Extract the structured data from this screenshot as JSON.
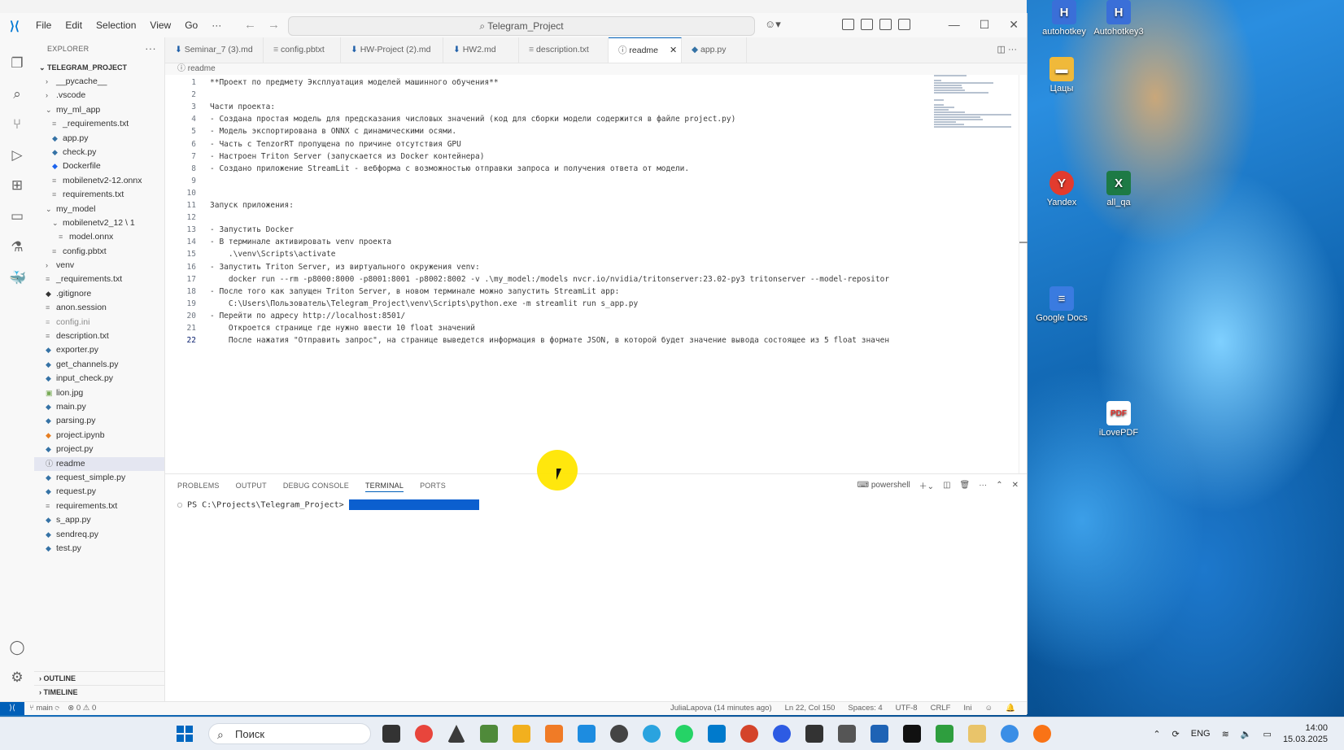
{
  "window": {
    "title": "Telegram_Project",
    "menu": [
      "File",
      "Edit",
      "Selection",
      "View",
      "Go",
      "···"
    ]
  },
  "explorer": {
    "header": "EXPLORER",
    "root": "TELEGRAM_PROJECT",
    "items": [
      {
        "label": "__pycache__",
        "indent": 1,
        "kind": "folder-closed"
      },
      {
        "label": ".vscode",
        "indent": 1,
        "kind": "folder-closed"
      },
      {
        "label": "my_ml_app",
        "indent": 1,
        "kind": "folder-open"
      },
      {
        "label": "_requirements.txt",
        "indent": 2,
        "kind": "txt"
      },
      {
        "label": "app.py",
        "indent": 2,
        "kind": "py"
      },
      {
        "label": "check.py",
        "indent": 2,
        "kind": "py"
      },
      {
        "label": "Dockerfile",
        "indent": 2,
        "kind": "docker"
      },
      {
        "label": "mobilenetv2-12.onnx",
        "indent": 2,
        "kind": "txt"
      },
      {
        "label": "requirements.txt",
        "indent": 2,
        "kind": "txt"
      },
      {
        "label": "my_model",
        "indent": 1,
        "kind": "folder-open"
      },
      {
        "label": "mobilenetv2_12 \\ 1",
        "indent": 2,
        "kind": "folder-open"
      },
      {
        "label": "model.onnx",
        "indent": 3,
        "kind": "txt"
      },
      {
        "label": "config.pbtxt",
        "indent": 2,
        "kind": "txt"
      },
      {
        "label": "venv",
        "indent": 1,
        "kind": "folder-closed"
      },
      {
        "label": "_requirements.txt",
        "indent": 1,
        "kind": "txt"
      },
      {
        "label": ".gitignore",
        "indent": 1,
        "kind": "git"
      },
      {
        "label": "anon.session",
        "indent": 1,
        "kind": "txt"
      },
      {
        "label": "config.ini",
        "indent": 1,
        "kind": "dim"
      },
      {
        "label": "description.txt",
        "indent": 1,
        "kind": "txt"
      },
      {
        "label": "exporter.py",
        "indent": 1,
        "kind": "py"
      },
      {
        "label": "get_channels.py",
        "indent": 1,
        "kind": "py"
      },
      {
        "label": "input_check.py",
        "indent": 1,
        "kind": "py"
      },
      {
        "label": "lion.jpg",
        "indent": 1,
        "kind": "img"
      },
      {
        "label": "main.py",
        "indent": 1,
        "kind": "py"
      },
      {
        "label": "parsing.py",
        "indent": 1,
        "kind": "py"
      },
      {
        "label": "project.ipynb",
        "indent": 1,
        "kind": "nb"
      },
      {
        "label": "project.py",
        "indent": 1,
        "kind": "py"
      },
      {
        "label": "readme",
        "indent": 1,
        "kind": "info",
        "selected": true
      },
      {
        "label": "request_simple.py",
        "indent": 1,
        "kind": "py"
      },
      {
        "label": "request.py",
        "indent": 1,
        "kind": "py"
      },
      {
        "label": "requirements.txt",
        "indent": 1,
        "kind": "txt"
      },
      {
        "label": "s_app.py",
        "indent": 1,
        "kind": "py"
      },
      {
        "label": "sendreq.py",
        "indent": 1,
        "kind": "py"
      },
      {
        "label": "test.py",
        "indent": 1,
        "kind": "py"
      }
    ],
    "outline": "OUTLINE",
    "timeline": "TIMELINE"
  },
  "tabs": [
    {
      "label": "Seminar_7 (3).md",
      "icon": "md"
    },
    {
      "label": "config.pbtxt",
      "icon": "txt"
    },
    {
      "label": "HW-Project (2).md",
      "icon": "md"
    },
    {
      "label": "HW2.md",
      "icon": "md"
    },
    {
      "label": "description.txt",
      "icon": "txt"
    },
    {
      "label": "readme",
      "icon": "info",
      "active": true
    },
    {
      "label": "app.py",
      "icon": "py"
    }
  ],
  "breadcrumb": "readme",
  "code_lines": [
    "**Проект по предмету Эксплуатация моделей машинного обучения**",
    "",
    "Части проекта:",
    "- Создана простая модель для предсказания числовых значений (код для сборки модели содержится в файле project.py)",
    "- Модель экспортирована в ONNX с динамическими осями.",
    "- Часть с TenzorRT пропущена по причине отсутствия GPU",
    "- Настроен Triton Server (запускается из Docker контейнера)",
    "- Создано приложение StreamLit - вебформа с возможностью отправки запроса и получения ответа от модели.",
    "",
    "",
    "Запуск приложения:",
    "",
    "- Запустить Docker",
    "- В терминале активировать venv проекта",
    "    .\\venv\\Scripts\\activate",
    "- Запустить Triton Server, из виртуального окружения venv:",
    "    docker run --rm -p8000:8000 -p8001:8001 -p8002:8002 -v .\\my_model:/models nvcr.io/nvidia/tritonserver:23.02-py3 tritonserver --model-repositor",
    "- После того как запущен Triton Server, в новом терминале можно запустить StreamLit app:",
    "    C:\\Users\\Пользователь\\Telegram_Project\\venv\\Scripts\\python.exe -m streamlit run s_app.py",
    "- Перейти по адресу http://localhost:8501/",
    "    Откроется странице где нужно ввести 10 float значений",
    "    После нажатия \"Отправить запрос\", на странице выведется информация в формате JSON, в которой будет значение вывода состоящее из 5 float значен"
  ],
  "panel": {
    "tabs": [
      "PROBLEMS",
      "OUTPUT",
      "DEBUG CONSOLE",
      "TERMINAL",
      "PORTS"
    ],
    "active_tab": "TERMINAL",
    "shell": "powershell",
    "prompt": "PS C:\\Projects\\Telegram_Project>"
  },
  "statusbar": {
    "branch": "main",
    "problems": "⊗ 0 ⚠ 0",
    "blame": "JuliaLapova (14 minutes ago)",
    "position": "Ln 22, Col 150",
    "spaces": "Spaces: 4",
    "encoding": "UTF-8",
    "eol": "CRLF",
    "language": "Ini"
  },
  "desktop_icons": [
    {
      "label": "autohotkey",
      "color": "#3a6fd8"
    },
    {
      "label": "Autohotkey3",
      "color": "#3a6fd8"
    },
    {
      "label": "Цацы",
      "color": "#f0b93a"
    },
    {
      "label": "Yandex",
      "color": "#e23b2e"
    },
    {
      "label": "all_qa",
      "color": "#1d7a45"
    },
    {
      "label": "Google Docs",
      "color": "#3a7be0"
    },
    {
      "label": "iLovePDF",
      "color": "#e3342f"
    }
  ],
  "taskbar": {
    "search_placeholder": "Поиск",
    "lang": "ENG",
    "time": "14:00",
    "date": "15.03.2025"
  },
  "colors": {
    "accent": "#005fb8",
    "py_icon": "#3572a5",
    "md_icon": "#1f5fa8",
    "cursor_highlight": "#ffe600"
  }
}
